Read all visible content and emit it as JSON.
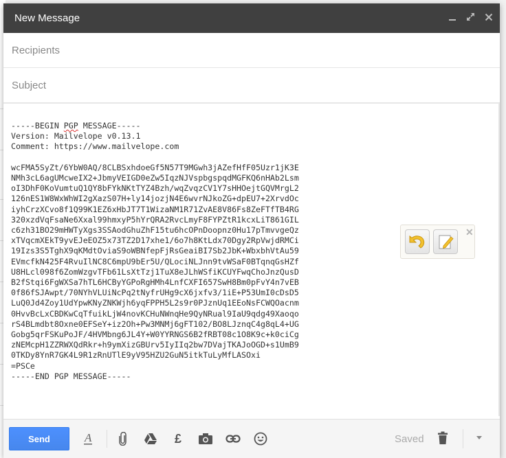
{
  "window": {
    "title": "New Message",
    "controls": {
      "minimize": "minimize-icon",
      "popout": "expand-icon",
      "close": "close-icon"
    }
  },
  "fields": {
    "recipients_placeholder": "Recipients",
    "subject_placeholder": "Subject"
  },
  "body": {
    "pgp_lines": [
      "-----BEGIN PGP MESSAGE-----",
      "Version: Mailvelope v0.13.1",
      "Comment: https://www.mailvelope.com",
      "",
      "wcFMA5SyZt/6YbW0AQ/8CLBSxhdoeGf5N57T9MGwh3jAZefHfF05Uzr1jK3E",
      "NMh3cL6agUMcweIX2+JbmyVEIGD0eZw5IqzNJVspbgspqdMGFKQ6nHAb2Lsm",
      "oI3DhF0KoVumtuQ1QY8bFYkNKtTYZ4Bzh/wqZvqzCV1Y7sHHOejtGQVMrgL2",
      "126nES1W8WxWhWI2gXazS07H+ly14jozjN4E6wvrNJkoZG+dpEU7+2XrvdOc",
      "iyhCrzXCvo8f1Q99K1EZ6xHbJT7T1WizaNM1R71ZvAE8V86Fs8ZeFTfTB4RG",
      "320xzdVqFsaNe6Xxal99hmxyP5hYrQRA2RvcLmyF8FYPZtR1kcxLiT861GIL",
      "c6zh31BO29mHWTyXgs3SSAodGhuZhF15tu6hcOPnDoopnz0Hu17pTmvvgeQz",
      "xTVqcmXEkT9yvEJeEOZ5x73TZ2D17xhe1/6o7h8KtLdx70Dgy2RpVwjdRMCi",
      "19Izs3S5TghX9qKMdtOviaS9oWBNfepFjRsGeaiBI7Sb2JbK+WbxbhVtAu59",
      "EVmcfkN425F4RvuIlNC8C6mpU9bEr5U/QLociNLJnn9tvWSaF0BTqnqGsHZf",
      "U8HLcl098f6ZomWzgvTFb61LsXtTzj1TuX8eJLhWSfiKCUYFwqChoJnzQusD",
      "B2fStqi6FgWXSa7hTL6HCByYGPoRgHMh4LnfCXFI657SwH8Bm0pFvY4n7vEB",
      "0f86fSJAwpt/70NYhVLUiNcPq2tNyfrUHg9cX6jxfv3/1iE+P53UmI0cDsD5",
      "LuQ0Jd4Zoy1UdYpwKNyZNKWjh6yqFPPH5L2s9r0PJznUq1EEoNsFCWQOacnm",
      "0HvvBcLxCBDKwCqTfuikLjW4novKCHuNWnqHe9QyNRual9IaU9qdg49Xaoqo",
      "rS4BLmdbt8Oxne0EFSeY+iz2Oh+Pw3MNMj6gFT102/BO8LJznqC4g8qL4+UG",
      "Gobg5qrFSKuPoJF/4HVMbng6JL4Y+W0YYRNGS6B2fRBT08c1O8K9c+k0ciCg",
      "zNEMcpH1ZZRWXQdRkr+h9ymXizGBUrv5IyIIq2bw7DVajTKAJoOGD+s1UmB9",
      "0TKDy8YnR7GK4L9R1zRnUTlE9yV95HZU2GuN5itkTuLyMfLASOxi",
      "=PSCe",
      "-----END PGP MESSAGE-----"
    ]
  },
  "mailvelope": {
    "undo_icon": "undo-arrow-icon",
    "edit_icon": "edit-pencil-icon",
    "close_icon": "close-icon"
  },
  "toolbar": {
    "send_label": "Send",
    "icons": [
      "formatting-icon",
      "attach-icon",
      "drive-icon",
      "money-icon",
      "photo-icon",
      "link-icon",
      "emoji-icon"
    ],
    "saved_status": "Saved",
    "discard_icon": "trash-icon",
    "more_icon": "more-options-icon"
  },
  "colors": {
    "header_bg": "#404040",
    "send_blue": "#4d90fe",
    "mailvelope_yellow": "#f2c12e"
  }
}
